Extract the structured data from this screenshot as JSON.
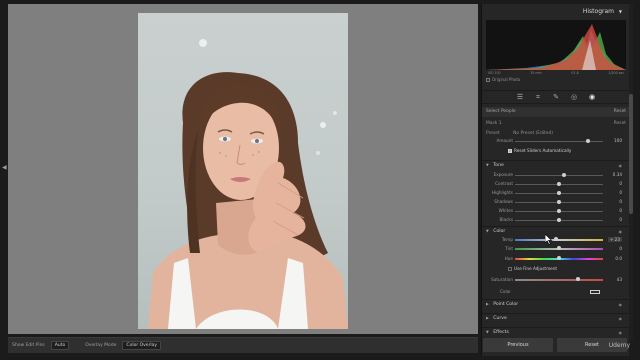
{
  "histogram": {
    "title": "Histogram",
    "ticks": [
      "ISO 100",
      "35 mm",
      "f/1.8",
      "1/200 sec"
    ],
    "original_photo_label": "Original Photo"
  },
  "tools": [
    {
      "icon": "sliders-icon"
    },
    {
      "icon": "crop-icon"
    },
    {
      "icon": "heal-icon"
    },
    {
      "icon": "red-eye-icon"
    },
    {
      "icon": "masking-icon"
    }
  ],
  "mask_panel": {
    "select_people": "Select People",
    "reset": "Reset",
    "mask_label": "Mask 1",
    "mask_reset": "Reset",
    "preset_label": "Preset",
    "preset_value": "No Preset (Edited)",
    "amount_label": "Amount",
    "amount_value": "100",
    "reset_sliders_label": "Reset Sliders Automatically"
  },
  "light": {
    "title": "Tone",
    "sliders": [
      {
        "label": "Exposure",
        "value": "0.34",
        "pos": 0.56
      },
      {
        "label": "Contrast",
        "value": "0",
        "pos": 0.5
      },
      {
        "label": "Highlights",
        "value": "0",
        "pos": 0.5
      },
      {
        "label": "Shadows",
        "value": "0",
        "pos": 0.5
      },
      {
        "label": "Whites",
        "value": "0",
        "pos": 0.5
      },
      {
        "label": "Blacks",
        "value": "0",
        "pos": 0.5
      }
    ]
  },
  "color": {
    "title": "Color",
    "temp_label": "Temp",
    "temp_value": "+ 23",
    "temp_pos": 0.47,
    "tint_label": "Tint",
    "tint_value": "0",
    "hue_label": "Hue",
    "hue_value": "0.0",
    "hue_pos": 0.5,
    "fine_adjust_label": "Use Fine Adjustment",
    "saturation_label": "Saturation",
    "saturation_value": "43",
    "saturation_pos": 0.72,
    "color_label": "Color"
  },
  "sections": [
    "Point Color",
    "Curve",
    "Effects"
  ],
  "buttons": {
    "previous": "Previous",
    "reset": "Reset"
  },
  "toolbar": {
    "view_label": "Show Edit Pins",
    "view_value": "Auto",
    "overlay_label": "Overlay Mode",
    "overlay_value": "Color Overlay"
  },
  "watermark": "Udemy"
}
